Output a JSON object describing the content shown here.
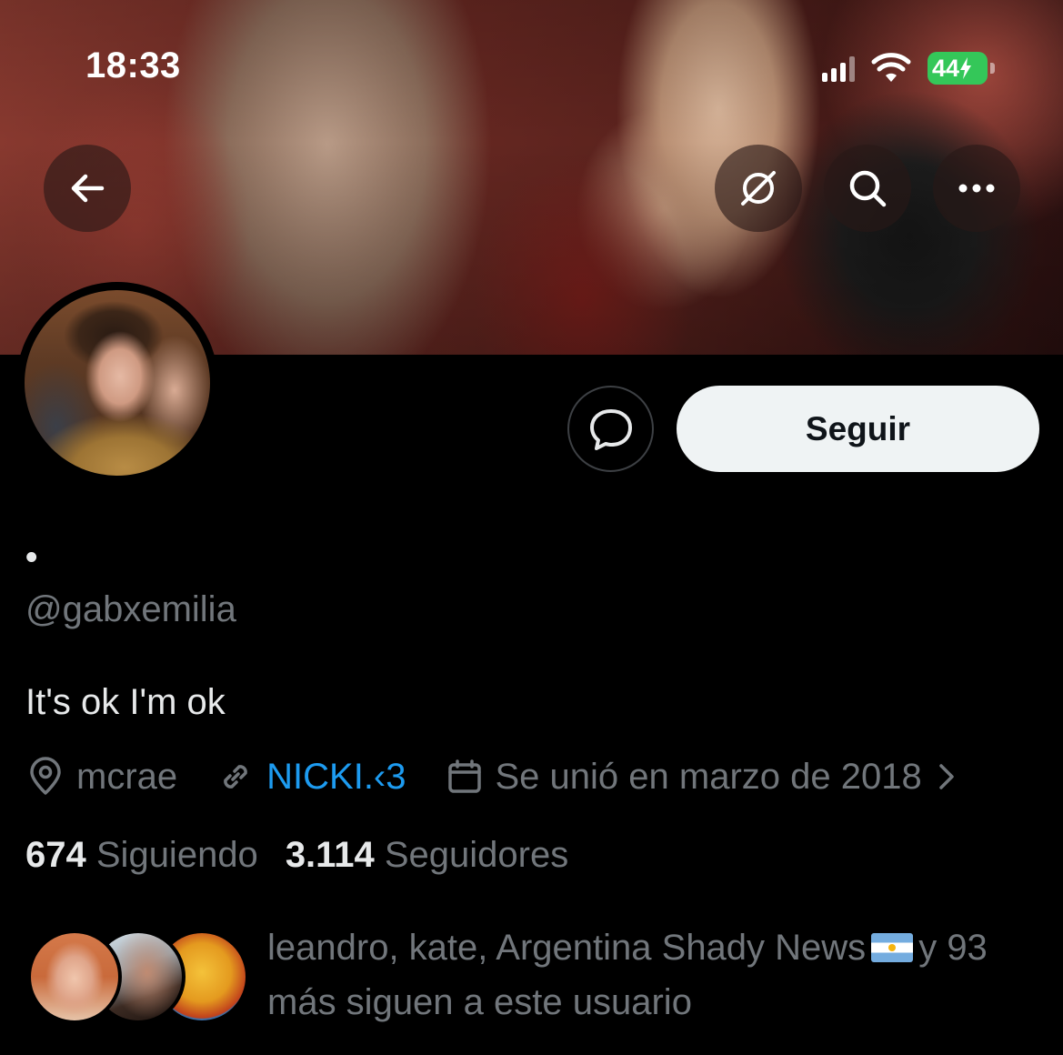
{
  "status_bar": {
    "time": "18:33",
    "battery": "44"
  },
  "header": {
    "back_icon": "arrow-left-icon",
    "grok_icon": "slashed-circle-icon",
    "search_icon": "search-icon",
    "more_icon": "more-horizontal-icon"
  },
  "profile": {
    "display_name": "•",
    "handle": "@gabxemilia",
    "bio": "It's ok I'm ok",
    "location": "mcrae",
    "link": "NICKI.‹3",
    "joined": "Se unió en marzo de 2018"
  },
  "actions": {
    "message_icon": "message-bubble-icon",
    "follow_label": "Seguir"
  },
  "stats": {
    "following_count": "674",
    "following_label": "Siguiendo",
    "followers_count": "3.114",
    "followers_label": "Seguidores"
  },
  "followed_by": {
    "names": "leandro, kate, Argentina Shady News",
    "flag": "flag-argentina",
    "conj": "y",
    "rest": "93 más siguen a este usuario"
  },
  "colors": {
    "background": "#000000",
    "text_primary": "#e7e9ea",
    "text_secondary": "#71767b",
    "link": "#1d9bf0",
    "follow_button_bg": "#eff3f4",
    "battery_green": "#34c759"
  }
}
